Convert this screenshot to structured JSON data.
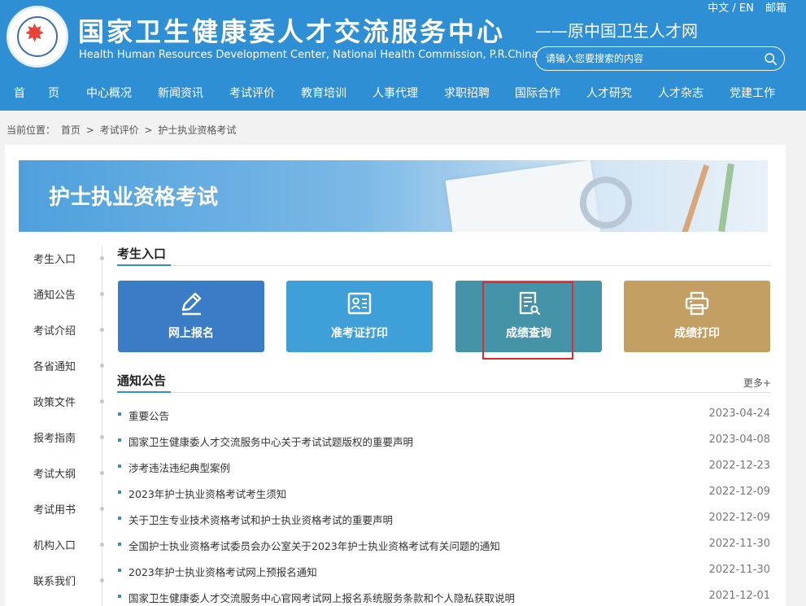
{
  "header": {
    "logo_name": "site-logo",
    "title": "国家卫生健康委人才交流服务中心",
    "subtitle": "Health Human Resources Development Center, National Health Commission, P.R.China",
    "former_name": "——原中国卫生人才网",
    "lang_link": "中文 / EN",
    "mail_link": "邮箱",
    "search_placeholder": "请输入您要搜索的内容",
    "search_icon": "search-icon"
  },
  "nav": {
    "items": [
      {
        "label": "首　　页"
      },
      {
        "label": "中心概况"
      },
      {
        "label": "新闻资讯"
      },
      {
        "label": "考试评价"
      },
      {
        "label": "教育培训"
      },
      {
        "label": "人事代理"
      },
      {
        "label": "求职招聘"
      },
      {
        "label": "国际合作"
      },
      {
        "label": "人才研究"
      },
      {
        "label": "人才杂志"
      },
      {
        "label": "党建工作"
      }
    ]
  },
  "breadcrumb": {
    "prefix": "当前位置：",
    "home": "首页",
    "sep": ">",
    "level1": "考试评价",
    "level2": "护士执业资格考试"
  },
  "banner": {
    "title": "护士执业资格考试"
  },
  "side_menu": {
    "items": [
      {
        "label": "考生入口"
      },
      {
        "label": "通知公告"
      },
      {
        "label": "考试介绍"
      },
      {
        "label": "各省通知"
      },
      {
        "label": "政策文件"
      },
      {
        "label": "报考指南"
      },
      {
        "label": "考试大纲"
      },
      {
        "label": "考试用书"
      },
      {
        "label": "机构入口"
      },
      {
        "label": "联系我们"
      }
    ]
  },
  "entry": {
    "heading": "考生入口",
    "tiles": [
      {
        "label": "网上报名",
        "icon": "pencil-icon",
        "color": "#3a7cc6"
      },
      {
        "label": "准考证打印",
        "icon": "id-card-icon",
        "color": "#3e9fd9"
      },
      {
        "label": "成绩查询",
        "icon": "document-search-icon",
        "color": "#4593a8"
      },
      {
        "label": "成绩打印",
        "icon": "printer-icon",
        "color": "#c49f63"
      }
    ],
    "highlight_color": "#e5292f"
  },
  "notices": {
    "heading": "通知公告",
    "more": "更多+",
    "items": [
      {
        "title": "重要公告",
        "date": "2023-04-24"
      },
      {
        "title": "国家卫生健康委人才交流服务中心关于考试试题版权的重要声明",
        "date": "2023-04-08"
      },
      {
        "title": "涉考违法违纪典型案例",
        "date": "2022-12-23"
      },
      {
        "title": "2023年护士执业资格考试考生须知",
        "date": "2022-12-09"
      },
      {
        "title": "关于卫生专业技术资格考试和护士执业资格考试的重要声明",
        "date": "2022-12-09"
      },
      {
        "title": "全国护士执业资格考试委员会办公室关于2023年护士执业资格考试有关问题的通知",
        "date": "2022-11-30"
      },
      {
        "title": "2023年护士执业资格考试网上预报名通知",
        "date": "2022-11-30"
      },
      {
        "title": "国家卫生健康委人才交流服务中心官网考试网上报名系统服务条款和个人隐私获取说明",
        "date": "2021-12-01"
      }
    ]
  },
  "colors": {
    "brand": "#2f8fd4",
    "page_bg": "#f2f2f2"
  }
}
